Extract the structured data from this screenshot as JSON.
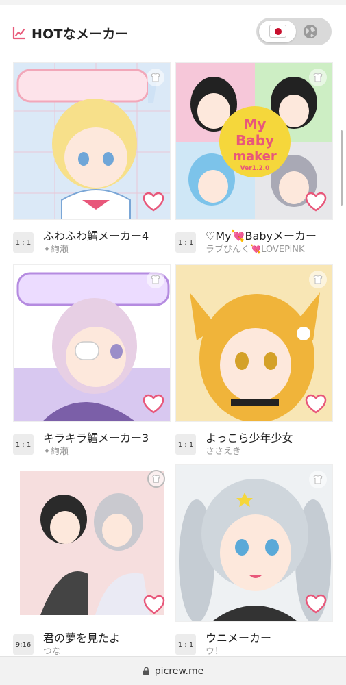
{
  "header": {
    "title": "HOTなメーカー",
    "accent": "#e85a7a",
    "chart_icon": "chart-line-icon"
  },
  "lang_toggle": {
    "selected": "ja",
    "options": [
      "flag-jp-icon",
      "globe-icon"
    ]
  },
  "makers": [
    {
      "title": "ふわふわ鱈メーカー4",
      "author": "✦絢瀬",
      "ratio": "1 : 1",
      "bg": "#dbe9f7",
      "accent": "#f2a7b9"
    },
    {
      "title": "♡My💘Babyメーカー",
      "author": "ラブぴんく💘LOVEPiNK",
      "ratio": "1 : 1",
      "bg": "#f6c7d9",
      "accent": "#f5d73b"
    },
    {
      "title": "キラキラ鱈メーカー3",
      "author": "✦絢瀬",
      "ratio": "1 : 1",
      "bg": "#e3d2f2",
      "accent": "#b58be0"
    },
    {
      "title": "よっこら少年少女",
      "author": "ささえき",
      "ratio": "1 : 1",
      "bg": "#f8e6b5",
      "accent": "#f0b43a"
    },
    {
      "title": "君の夢を見たよ",
      "author": "つな",
      "ratio": "9:16",
      "bg": "#f6dede",
      "accent": "#5a4a4a"
    },
    {
      "title": "ウニメーカー",
      "author": "ウ！",
      "ratio": "1 : 1",
      "bg": "#eef1f3",
      "accent": "#9fb3c3"
    }
  ],
  "urlbar": {
    "url": "picrew.me"
  },
  "colors": {
    "heart": "#e8577a",
    "ratio_bg": "#ececec",
    "toggle_bg": "#d9d9d9"
  }
}
